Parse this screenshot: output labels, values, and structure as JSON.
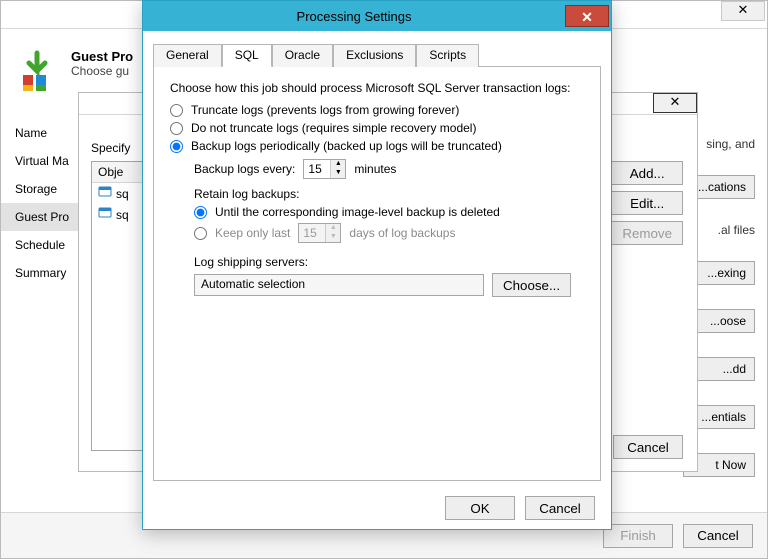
{
  "back": {
    "header_title": "Guest Pro",
    "header_sub": "Choose gu",
    "nav": {
      "items": [
        "Name",
        "Virtual Ma",
        "Storage",
        "Guest Pro",
        "Schedule",
        "Summary"
      ],
      "active_index": 3
    },
    "right_text_frags": [
      "sing, and",
      "al files."
    ],
    "right_btn_frags": [
      "cations...",
      "exing...",
      "oose...",
      "dd...",
      "entials...",
      "t Now"
    ],
    "footer": {
      "finish": "Finish",
      "cancel": "Cancel"
    }
  },
  "mid": {
    "specify_label": "Specify",
    "list_header": "Obje",
    "list_items": [
      "sq",
      "sq"
    ],
    "buttons": {
      "add": "Add...",
      "edit": "Edit...",
      "remove": "Remove"
    },
    "cancel": "Cancel"
  },
  "modal": {
    "title": "Processing Settings",
    "tabs": [
      "General",
      "SQL",
      "Oracle",
      "Exclusions",
      "Scripts"
    ],
    "active_tab_index": 1,
    "desc": "Choose how this job should process Microsoft SQL Server transaction logs:",
    "opt_truncate": "Truncate logs (prevents logs from growing forever)",
    "opt_no_truncate": "Do not truncate logs (requires simple recovery model)",
    "opt_backup_periodic": "Backup logs periodically (backed up logs will be truncated)",
    "backup_every_label": "Backup logs every:",
    "backup_every_value": "15",
    "backup_every_unit": "minutes",
    "retain_label": "Retain log backups:",
    "retain_opt_until": "Until the corresponding image-level backup is deleted",
    "retain_opt_keep": "Keep only last",
    "retain_days_value": "15",
    "retain_opt_keep_suffix": "days of log backups",
    "log_ship_label": "Log shipping servers:",
    "log_ship_value": "Automatic selection",
    "choose": "Choose...",
    "ok": "OK",
    "cancel": "Cancel"
  }
}
